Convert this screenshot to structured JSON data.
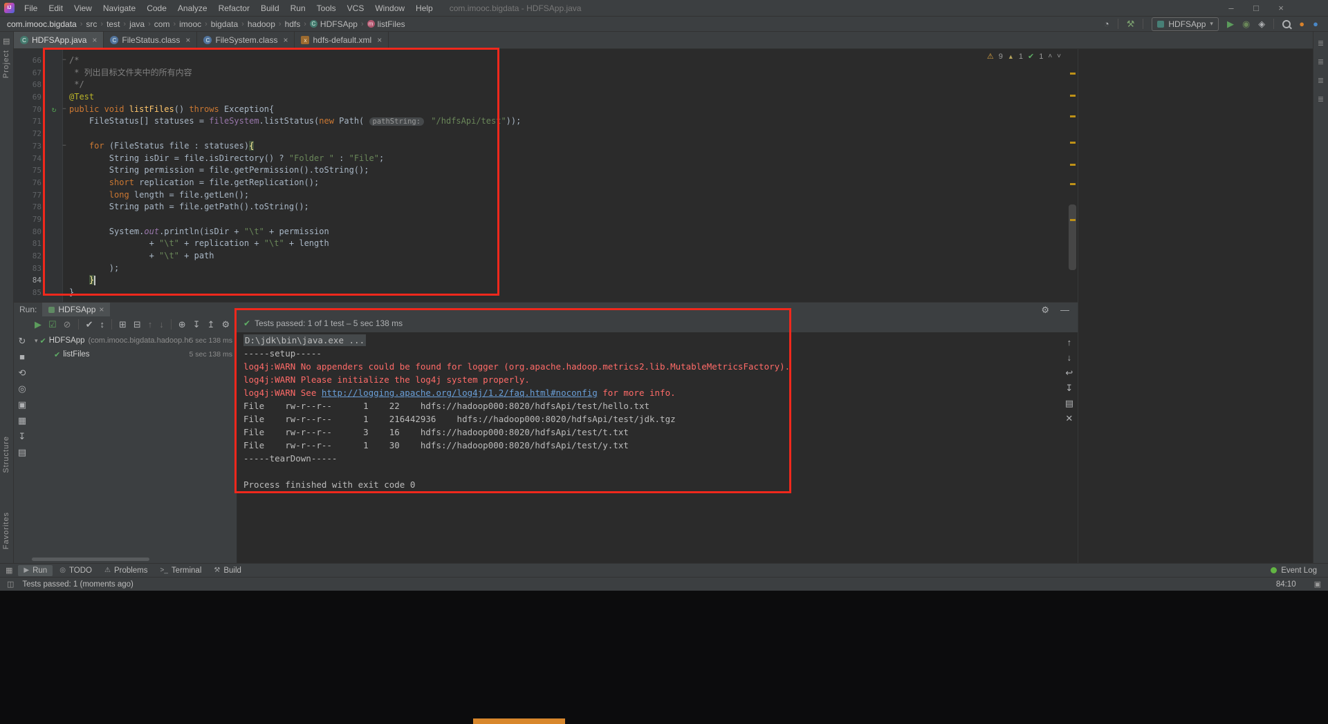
{
  "window": {
    "app_badge": "IJ",
    "title": "com.imooc.bigdata - HDFSApp.java",
    "menu": [
      "File",
      "Edit",
      "View",
      "Navigate",
      "Code",
      "Analyze",
      "Refactor",
      "Build",
      "Run",
      "Tools",
      "VCS",
      "Window",
      "Help"
    ],
    "controls": {
      "minimize": "–",
      "maximize": "□",
      "close": "×"
    }
  },
  "navbar": {
    "breadcrumbs": [
      "com.imooc.bigdata",
      "src",
      "test",
      "java",
      "com",
      "imooc",
      "bigdata",
      "hadoop",
      "hdfs"
    ],
    "class_crumb": "HDFSApp",
    "method_crumb": "listFiles",
    "icons_pre": [
      {
        "name": "profile-icon",
        "glyph": "◔",
        "color": "#afb1b3"
      },
      {
        "sep": true
      },
      {
        "name": "build-project-icon",
        "glyph": "⚒",
        "color": "#7ba06f"
      },
      {
        "sep": true
      }
    ],
    "run_config": {
      "label": "HDFSApp",
      "dropdown_glyph": "▾"
    },
    "icons_post": [
      {
        "name": "run-icon",
        "glyph": "▶",
        "color": "#5c9c5c"
      },
      {
        "name": "debug-icon",
        "glyph": "◉",
        "color": "#6a8759"
      },
      {
        "name": "coverage-icon",
        "glyph": "◈",
        "color": "#afb1b3"
      },
      {
        "sep": true
      },
      {
        "name": "search-everywhere-icon",
        "mag": true
      },
      {
        "name": "gradle-icon",
        "glyph": "●",
        "color": "#d9822b"
      },
      {
        "name": "notification-icon",
        "glyph": "●",
        "color": "#4a88c7"
      }
    ]
  },
  "left_strip": {
    "project": "Project",
    "structure": "Structure",
    "favorites": "Favorites"
  },
  "editor_tabs": [
    {
      "label": "HDFSApp.java",
      "icon": "class",
      "glyph": "C"
    },
    {
      "label": "FileStatus.class",
      "icon": "classfile",
      "glyph": "C"
    },
    {
      "label": "FileSystem.class",
      "icon": "classfile",
      "glyph": "C"
    },
    {
      "label": "hdfs-default.xml",
      "icon": "xml",
      "glyph": "x"
    }
  ],
  "editor": {
    "inspection": {
      "warnings": "9",
      "weak": "1",
      "ok": "1"
    },
    "lines": [
      {
        "n": 66,
        "fold": true,
        "t": [
          [
            "/*",
            "c"
          ]
        ]
      },
      {
        "n": 67,
        "t": [
          [
            " * 列出目标文件夹中的所有内容",
            "c"
          ]
        ]
      },
      {
        "n": 68,
        "t": [
          [
            " */",
            "c"
          ]
        ]
      },
      {
        "n": 69,
        "t": [
          [
            "@Test",
            "a"
          ]
        ]
      },
      {
        "n": 70,
        "fold": true,
        "run": true,
        "t": [
          [
            "public void ",
            "k"
          ],
          [
            "listFiles",
            "m"
          ],
          [
            "() ",
            "p"
          ],
          [
            "throws ",
            "k"
          ],
          [
            "Exception{",
            "p"
          ]
        ]
      },
      {
        "n": 71,
        "t": [
          [
            "    FileStatus[] statuses = ",
            "p"
          ],
          [
            "fileSystem",
            "f"
          ],
          [
            ".listStatus(",
            "p"
          ],
          [
            "new ",
            "k"
          ],
          [
            "Path( ",
            "p"
          ],
          [
            "pathString:",
            "h"
          ],
          [
            " ",
            "p"
          ],
          [
            "\"/hdfsApi/test\"",
            "s"
          ],
          [
            "));",
            "p"
          ]
        ]
      },
      {
        "n": 72,
        "t": []
      },
      {
        "n": 73,
        "fold": true,
        "t": [
          [
            "    ",
            "p"
          ],
          [
            "for",
            "k"
          ],
          [
            " (FileStatus file : statuses)",
            "p"
          ],
          [
            "{",
            "hl"
          ]
        ]
      },
      {
        "n": 74,
        "t": [
          [
            "        String isDir = file.isDirectory() ? ",
            "p"
          ],
          [
            "\"Folder \"",
            "s"
          ],
          [
            " : ",
            "p"
          ],
          [
            "\"File\"",
            "s"
          ],
          [
            ";",
            "p"
          ]
        ]
      },
      {
        "n": 75,
        "t": [
          [
            "        String permission = file.getPermission().toString();",
            "p"
          ]
        ]
      },
      {
        "n": 76,
        "t": [
          [
            "        ",
            "p"
          ],
          [
            "short",
            "k"
          ],
          [
            " replication = file.getReplication();",
            "p"
          ]
        ]
      },
      {
        "n": 77,
        "t": [
          [
            "        ",
            "p"
          ],
          [
            "long",
            "k"
          ],
          [
            " length = file.getLen();",
            "p"
          ]
        ]
      },
      {
        "n": 78,
        "t": [
          [
            "        String path = file.getPath().toString();",
            "p"
          ]
        ]
      },
      {
        "n": 79,
        "t": []
      },
      {
        "n": 80,
        "t": [
          [
            "        System.",
            "p"
          ],
          [
            "out",
            "sf"
          ],
          [
            ".println(isDir + ",
            "p"
          ],
          [
            "\"\\t\"",
            "s"
          ],
          [
            " + permission",
            "p"
          ]
        ]
      },
      {
        "n": 81,
        "t": [
          [
            "                + ",
            "p"
          ],
          [
            "\"\\t\"",
            "s"
          ],
          [
            " + replication + ",
            "p"
          ],
          [
            "\"\\t\"",
            "s"
          ],
          [
            " + length",
            "p"
          ]
        ]
      },
      {
        "n": 82,
        "t": [
          [
            "                + ",
            "p"
          ],
          [
            "\"\\t\"",
            "s"
          ],
          [
            " + path",
            "p"
          ]
        ]
      },
      {
        "n": 83,
        "t": [
          [
            "        );",
            "p"
          ]
        ]
      },
      {
        "n": 84,
        "cur": true,
        "caret": true,
        "t": [
          [
            "    ",
            "p"
          ],
          [
            "}",
            "hl"
          ]
        ]
      },
      {
        "n": 85,
        "t": [
          [
            "}",
            "p"
          ]
        ]
      }
    ]
  },
  "right_strip_icons": [
    {
      "name": "right-tool-icon-1",
      "glyph": "≣"
    },
    {
      "name": "right-tool-icon-2",
      "glyph": "≣"
    },
    {
      "name": "right-tool-icon-3",
      "glyph": "≣"
    },
    {
      "name": "right-tool-icon-4",
      "glyph": "≣"
    }
  ],
  "run_panel": {
    "label": "Run:",
    "tab": "HDFSApp",
    "header_icons": [
      {
        "name": "settings-gear-icon",
        "glyph": "⚙"
      },
      {
        "name": "hide-panel-icon",
        "glyph": "—"
      }
    ],
    "toolbar_icons": [
      {
        "name": "rerun-tests-icon",
        "glyph": "▶",
        "color": "#5c9c5c"
      },
      {
        "name": "rerun-failed-tests-icon",
        "glyph": "☑",
        "color": "#5c9c5c"
      },
      {
        "name": "stop-icon",
        "glyph": "⊘",
        "color": "#8a8a8a"
      },
      {
        "sep": true
      },
      {
        "name": "hide-passed-icon",
        "glyph": "✔",
        "color": "#afb1b3"
      },
      {
        "name": "sort-by-duration-icon",
        "glyph": "↕",
        "color": "#afb1b3"
      },
      {
        "sep": true
      },
      {
        "name": "expand-all-icon",
        "glyph": "⊞",
        "color": "#afb1b3"
      },
      {
        "name": "collapse-all-icon",
        "glyph": "⊟",
        "color": "#afb1b3"
      },
      {
        "name": "previous-failed-test-icon",
        "glyph": "↑",
        "color": "#6d6d6d"
      },
      {
        "name": "next-failed-test-icon",
        "glyph": "↓",
        "color": "#6d6d6d"
      },
      {
        "sep": true
      },
      {
        "name": "test-history-icon",
        "glyph": "⊕",
        "color": "#afb1b3"
      },
      {
        "name": "import-test-results-icon",
        "glyph": "↧",
        "color": "#afb1b3"
      },
      {
        "name": "export-test-results-icon",
        "glyph": "↥",
        "color": "#afb1b3"
      },
      {
        "name": "run-settings-icon",
        "glyph": "⚙",
        "color": "#afb1b3"
      }
    ],
    "status_text": "Tests passed: 1 of 1 test – 5 sec 138 ms",
    "tree": [
      {
        "level": 0,
        "name": "HDFSApp",
        "package": "(com.imooc.bigdata.hadoop.hdfs)",
        "time": "5 sec 138 ms"
      },
      {
        "level": 1,
        "name": "listFiles",
        "time": "5 sec 138 ms"
      }
    ],
    "left_icons": [
      {
        "name": "rerun-icon",
        "glyph": "↻"
      },
      {
        "name": "stop-process-icon",
        "glyph": "■"
      },
      {
        "name": "restore-layout-icon",
        "glyph": "⟲"
      },
      {
        "name": "pin-tab-icon",
        "glyph": "◎"
      },
      {
        "name": "thread-dump-icon",
        "glyph": "▣"
      },
      {
        "name": "memory-snapshot-icon",
        "glyph": "▦"
      },
      {
        "name": "attach-icon",
        "glyph": "↧"
      },
      {
        "name": "layout-icon",
        "glyph": "▤"
      }
    ],
    "console": [
      [
        [
          "D:\\jdk\\bin\\java.exe ...",
          "sel"
        ]
      ],
      [
        [
          "-----setup-----",
          "plain"
        ]
      ],
      [
        [
          "log4j:WARN No appenders could be found for logger (org.apache.hadoop.metrics2.lib.MutableMetricsFactory).",
          "err"
        ]
      ],
      [
        [
          "log4j:WARN Please initialize the log4j system properly.",
          "err"
        ]
      ],
      [
        [
          "log4j:WARN See ",
          "err"
        ],
        [
          "http://logging.apache.org/log4j/1.2/faq.html#noconfig",
          "link"
        ],
        [
          " for more info.",
          "err"
        ]
      ],
      [
        [
          "File    rw-r--r--      1    22    hdfs://hadoop000:8020/hdfsApi/test/hello.txt",
          "plain"
        ]
      ],
      [
        [
          "File    rw-r--r--      1    216442936    hdfs://hadoop000:8020/hdfsApi/test/jdk.tgz",
          "plain"
        ]
      ],
      [
        [
          "File    rw-r--r--      3    16    hdfs://hadoop000:8020/hdfsApi/test/t.txt",
          "plain"
        ]
      ],
      [
        [
          "File    rw-r--r--      1    30    hdfs://hadoop000:8020/hdfsApi/test/y.txt",
          "plain"
        ]
      ],
      [
        [
          "-----tearDown-----",
          "plain"
        ]
      ],
      [],
      [
        [
          "Process finished with exit code 0",
          "plain"
        ]
      ]
    ],
    "console_icons": [
      {
        "name": "scroll-up-icon",
        "glyph": "↑"
      },
      {
        "name": "scroll-down-icon",
        "glyph": "↓"
      },
      {
        "name": "soft-wrap-icon",
        "glyph": "↩"
      },
      {
        "name": "scroll-to-end-icon",
        "glyph": "↧"
      },
      {
        "name": "print-icon",
        "glyph": "▤"
      },
      {
        "name": "clear-console-icon",
        "glyph": "✕"
      }
    ]
  },
  "bottom_bar": {
    "switcher_glyph": "▦",
    "items": [
      {
        "label": "Run",
        "glyph": "▶",
        "active": true
      },
      {
        "label": "TODO",
        "glyph": "◎"
      },
      {
        "label": "Problems",
        "glyph": "⚠"
      },
      {
        "label": "Terminal",
        "glyph": ">_"
      },
      {
        "label": "Build",
        "glyph": "⚒"
      }
    ],
    "event_log": "Event Log"
  },
  "status_bar": {
    "message": "Tests passed: 1 (moments ago)",
    "caret_position": "84:10",
    "toolbox_glyph": "◫",
    "lock_glyph": "▣"
  }
}
